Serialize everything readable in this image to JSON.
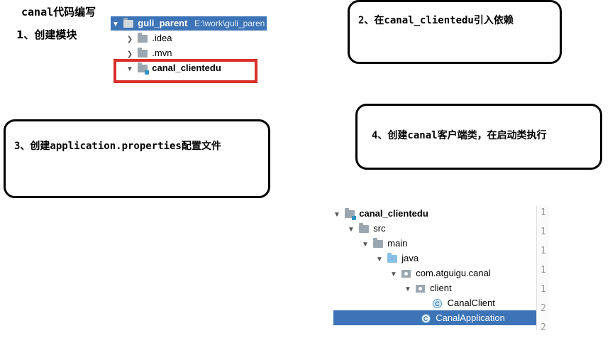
{
  "page_title": "canal代码编写",
  "step1": {
    "label": "1、创建模块",
    "tree": {
      "root_name": "guli_parent",
      "root_path": "E:\\work\\guli_paren",
      "items": [
        ".idea",
        ".mvn",
        "canal_clientedu"
      ]
    }
  },
  "step2": {
    "label": "2、在canal_clientedu引入依赖"
  },
  "step3": {
    "label": "3、创建application.properties配置文件"
  },
  "step4": {
    "label": "4、创建canal客户端类，在启动类执行"
  },
  "tree2": {
    "items": [
      "canal_clientedu",
      "src",
      "main",
      "java",
      "com.atguigu.canal",
      "client",
      "CanalClient",
      "CanalApplication"
    ],
    "class_icon_letter": "C",
    "gutter": [
      "1",
      "1",
      "1",
      "1",
      "1",
      "2",
      "2"
    ]
  },
  "colors": {
    "selection": "#3c74b7",
    "highlight_frame": "#d9302c"
  }
}
